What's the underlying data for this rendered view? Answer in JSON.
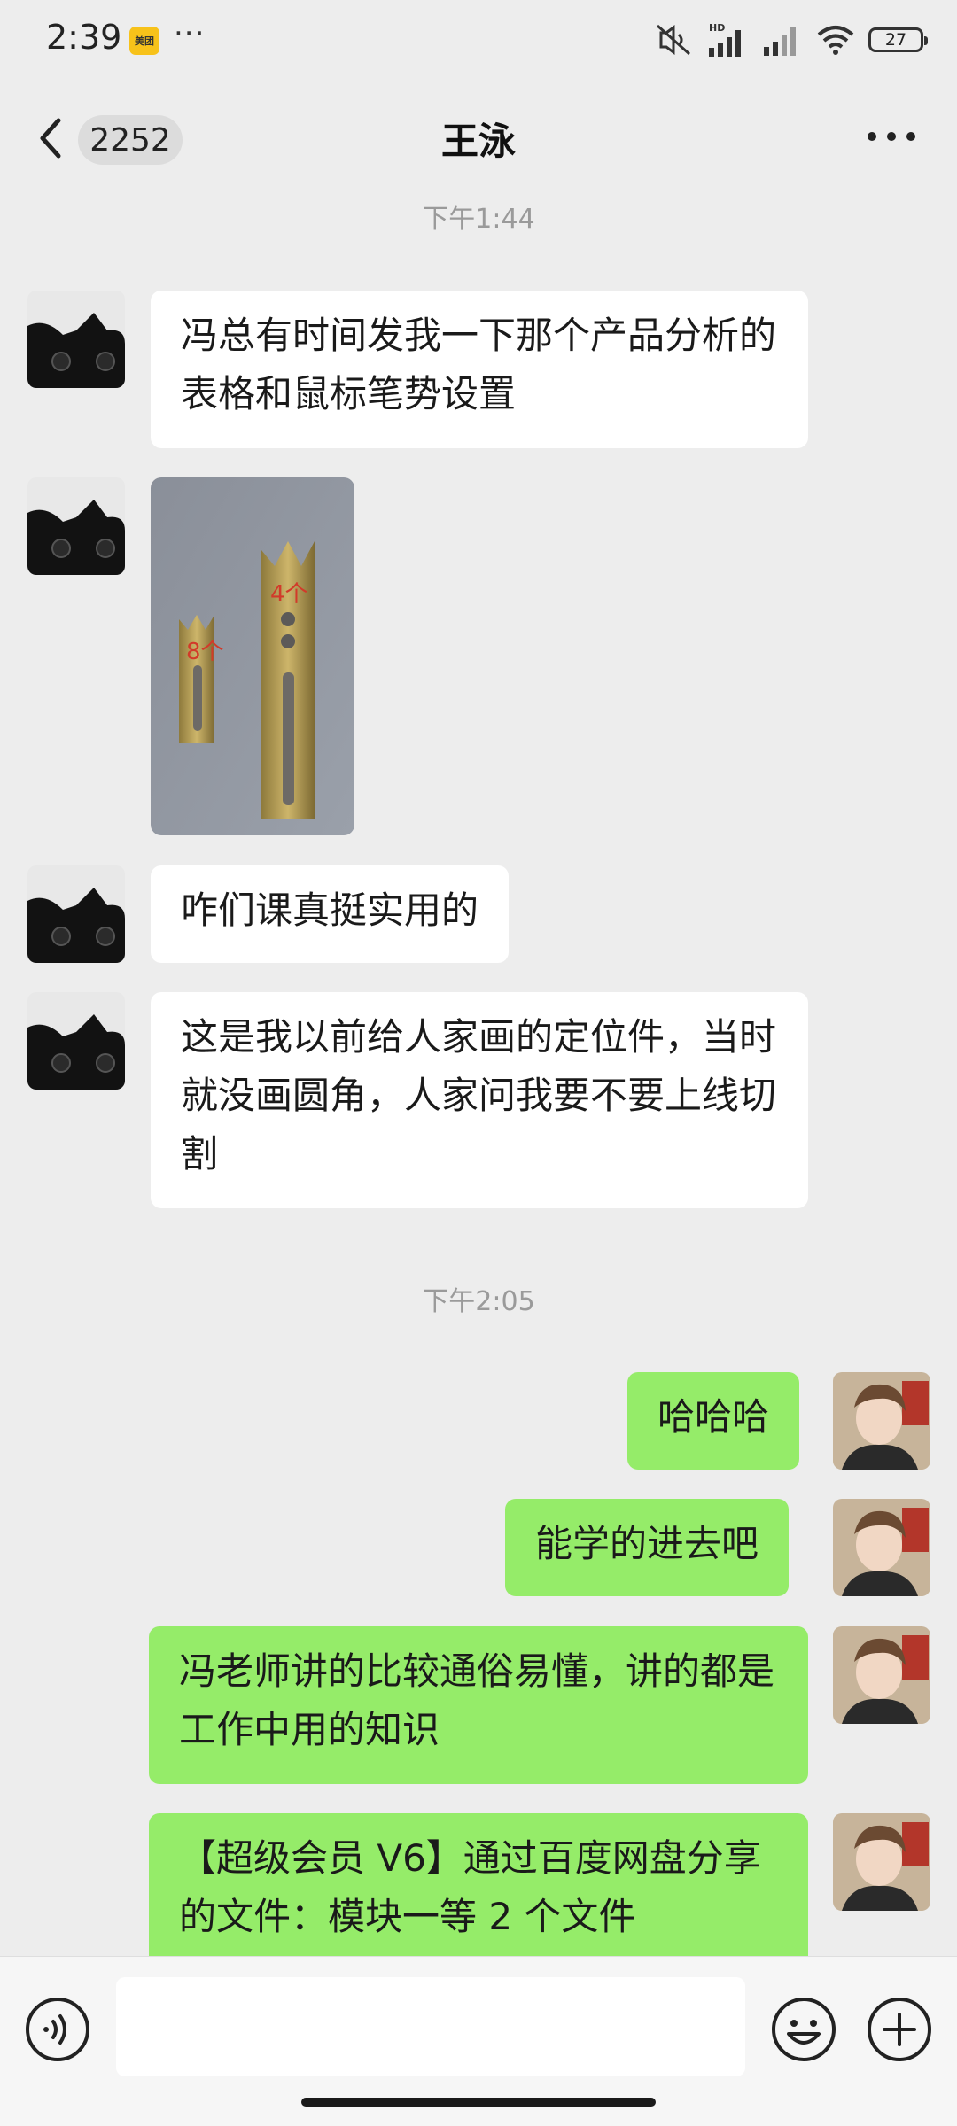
{
  "status_bar": {
    "time": "2:39",
    "app_badge": "美团",
    "more": "···",
    "battery": "27",
    "icons": [
      "mute-icon",
      "hd-signal-icon",
      "signal-icon",
      "wifi-icon",
      "battery-icon"
    ]
  },
  "header": {
    "unread_count": "2252",
    "title": "王泳",
    "icons": [
      "back-arrow-icon",
      "more-dots-icon"
    ]
  },
  "messages": {
    "timestamp_1": "下午1:44",
    "msg_1": "冯总有时间发我一下那个产品分析的表格和鼠标笔势设置",
    "image_labels": [
      "8个",
      "4个"
    ],
    "msg_3": "咋们课真挺实用的",
    "msg_4": "这是我以前给人家画的定位件，当时就没画圆角，人家问我要不要上线切割",
    "timestamp_2": "下午2:05",
    "msg_5": "哈哈哈",
    "msg_6": "能学的进去吧",
    "msg_7": "冯老师讲的比较通俗易懂，讲的都是工作中用的知识",
    "msg_8": "【超级会员 V6】通过百度网盘分享的文件：模块一等 2 个文件"
  },
  "input_bar": {
    "placeholder": "",
    "icons": [
      "voice-icon",
      "emoji-icon",
      "add-icon"
    ]
  },
  "colors": {
    "background": "#ededed",
    "bubble_self": "#95ec69",
    "bubble_other": "#ffffff",
    "timestamp": "#9a9a9a"
  }
}
